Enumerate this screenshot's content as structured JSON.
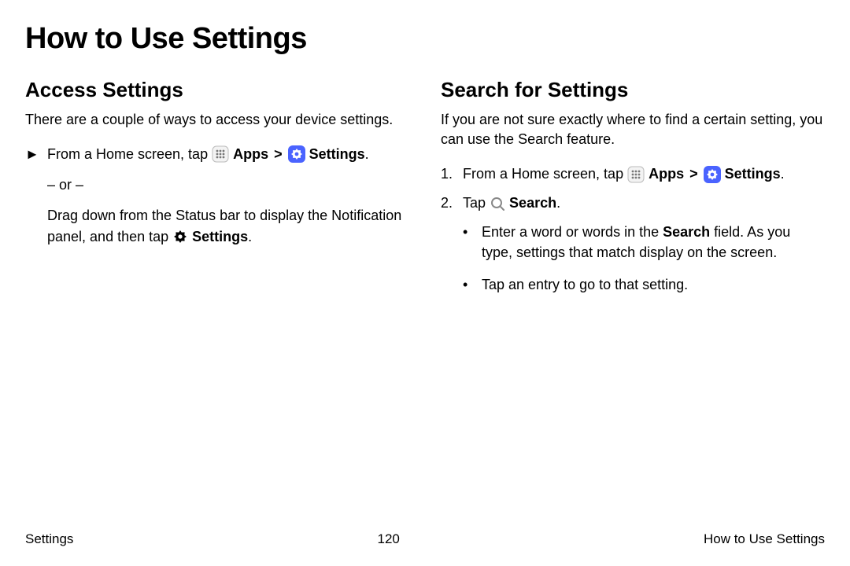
{
  "page_title": "How to Use Settings",
  "left": {
    "heading": "Access Settings",
    "intro": "There are a couple of ways to access your device settings.",
    "step1_lead": "From a Home screen, tap ",
    "apps_label": "Apps",
    "settings_label": "Settings",
    "or_text": "– or –",
    "alt_text_1": "Drag down from the Status bar to display the Notification panel, and then tap ",
    "alt_settings_label": "Settings"
  },
  "right": {
    "heading": "Search for Settings",
    "intro": "If you are not sure exactly where to find a certain setting, you can use the Search feature.",
    "step1_lead": "From a Home screen, tap ",
    "apps_label": "Apps",
    "settings_label": "Settings",
    "step2_lead": "Tap ",
    "search_label": "Search",
    "bullet1_a": "Enter a word or words in the ",
    "bullet1_bold": "Search",
    "bullet1_b": " field. As you type, settings that match display on the screen.",
    "bullet2": "Tap an entry to go to that setting."
  },
  "footer": {
    "left": "Settings",
    "center": "120",
    "right": "How to Use Settings"
  },
  "glyphs": {
    "tri": "►",
    "dot": "•",
    "period": ".",
    "chevron": ">"
  }
}
